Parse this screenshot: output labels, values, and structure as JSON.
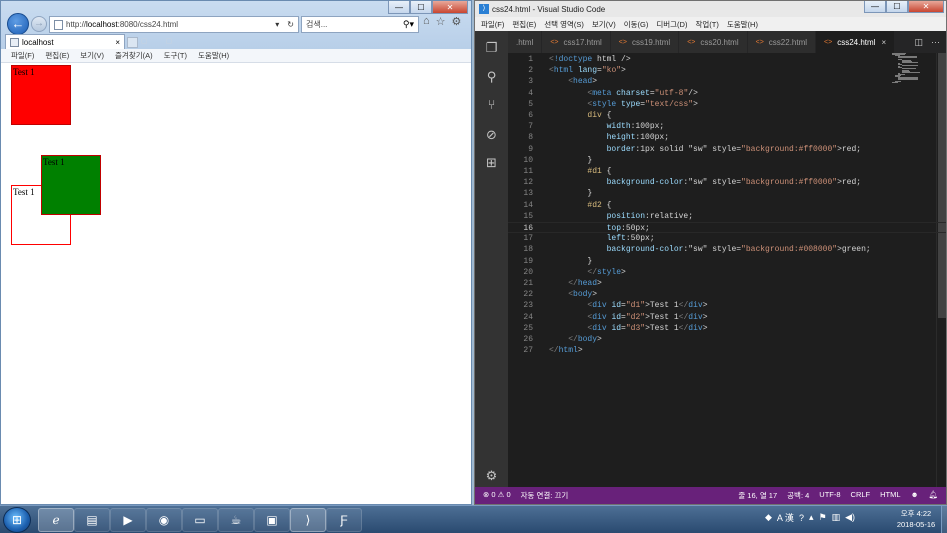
{
  "ie": {
    "url_prefix": "http://",
    "url_host": "localhost",
    "url_rest": ":8080/css24.html",
    "search_placeholder": "검색...",
    "tab_title": "localhost",
    "tab_close": "×",
    "menu": [
      "파일(F)",
      "편집(E)",
      "보기(V)",
      "즐겨찾기(A)",
      "도구(T)",
      "도움말(H)"
    ],
    "boxes": [
      {
        "id": "d1",
        "text": "Test 1"
      },
      {
        "id": "d2",
        "text": "Test 1"
      },
      {
        "id": "d3",
        "text": "Test 1"
      }
    ],
    "colors": {
      "red": "#ff0000",
      "green": "#008000"
    }
  },
  "vscode": {
    "window_title": "css24.html - Visual Studio Code",
    "menu": [
      "파일(F)",
      "편집(E)",
      "선택 영역(S)",
      "보기(V)",
      "이동(G)",
      "디버그(D)",
      "작업(T)",
      "도움말(H)"
    ],
    "tabs": [
      {
        "label": ".html",
        "active": false
      },
      {
        "label": "css17.html",
        "active": false
      },
      {
        "label": "css19.html",
        "active": false
      },
      {
        "label": "css20.html",
        "active": false
      },
      {
        "label": "css22.html",
        "active": false
      },
      {
        "label": "css24.html",
        "active": true
      }
    ],
    "code_lines": [
      "<!doctype html />",
      "<html lang=\"ko\">",
      "    <head>",
      "        <meta charset=\"utf-8\"/>",
      "        <style type=\"text/css\">",
      "        div {",
      "            width:100px;",
      "            height:100px;",
      "            border:1px solid red;",
      "        }",
      "        #d1 {",
      "            background-color:red;",
      "        }",
      "        #d2 {",
      "            position:relative;",
      "            top:50px;",
      "            left:50px;",
      "            background-color:green;",
      "        }",
      "        </style>",
      "    </head>",
      "    <body>",
      "        <div id=\"d1\">Test 1</div>",
      "        <div id=\"d2\">Test 1</div>",
      "        <div id=\"d3\">Test 1</div>",
      "    </body>",
      "</html>"
    ],
    "current_line": 16,
    "status": {
      "errors": "0",
      "warnings": "0",
      "connection": "자동 연결: 끄기",
      "position": "줄 16, 열 17",
      "spaces": "공백: 4",
      "encoding": "UTF-8",
      "eol": "CRLF",
      "language": "HTML"
    },
    "status_color": "#68217a"
  },
  "taskbar": {
    "clock_time": "오후 4:22",
    "clock_date": "2018-05-16",
    "ime": "A 漢"
  }
}
